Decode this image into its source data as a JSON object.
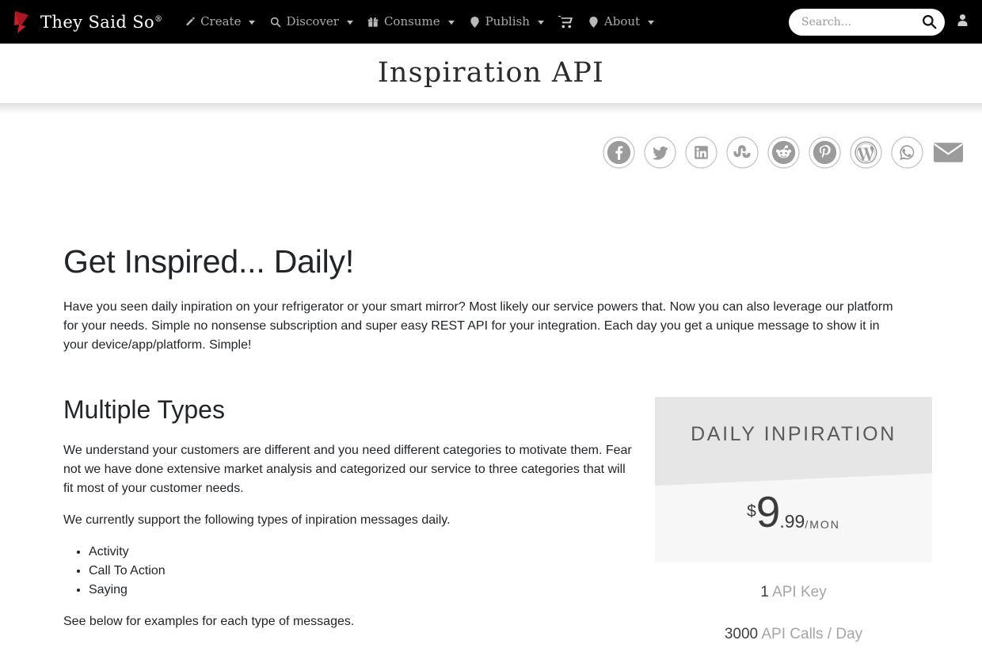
{
  "navbar": {
    "brand": {
      "name": "They Said So",
      "registered": "®",
      "logo_icon": "quill-logo-icon"
    },
    "items": [
      {
        "label": "Create",
        "icon": "pencil-icon",
        "has_caret": true
      },
      {
        "label": "Discover",
        "icon": "search-icon",
        "has_caret": true
      },
      {
        "label": "Consume",
        "icon": "gift-icon",
        "has_caret": true
      },
      {
        "label": "Publish",
        "icon": "location-pin-icon",
        "has_caret": true
      },
      {
        "label": "",
        "icon": "cart-icon",
        "has_caret": false
      },
      {
        "label": "About",
        "icon": "location-pin-icon",
        "has_caret": true
      }
    ],
    "search": {
      "placeholder": "Search...",
      "value": "",
      "button_icon": "search-icon"
    },
    "account_icon": "user-icon"
  },
  "header": {
    "title": "Inspiration API"
  },
  "share": {
    "buttons": [
      {
        "name": "facebook",
        "label": "Facebook"
      },
      {
        "name": "twitter",
        "label": "Twitter"
      },
      {
        "name": "linkedin",
        "label": "LinkedIn"
      },
      {
        "name": "stumbleupon",
        "label": "StumbleUpon"
      },
      {
        "name": "reddit",
        "label": "Reddit"
      },
      {
        "name": "pinterest",
        "label": "Pinterest"
      },
      {
        "name": "wordpress",
        "label": "WordPress"
      },
      {
        "name": "whatsapp",
        "label": "WhatsApp"
      },
      {
        "name": "email",
        "label": "Email"
      }
    ]
  },
  "hero": {
    "title": "Get Inspired... Daily!",
    "paragraph": "Have you seen daily inpiration on your refrigerator or your smart mirror? Most likely our service powers that. Now you can also leverage our platform for your needs. Simple no nonsense subscription and super easy REST API for your integration. Each day you get a unique message to show it in your device/app/platform. Simple!"
  },
  "multiple_types": {
    "title": "Multiple Types",
    "paragraph_1": "We understand your customers are different and you need different categories to motivate them. Fear not we have done extensive market analysis and categorized our service to three categories that will fit most of your customer needs.",
    "paragraph_2": "We currently support the following types of inpiration messages daily.",
    "types": [
      "Activity",
      "Call To Action",
      "Saying"
    ],
    "paragraph_3": "See below for examples for each type of messages."
  },
  "pricing": {
    "plan_name": "DAILY INPIRATION",
    "currency": "$",
    "amount": "9",
    "cents": ".99",
    "period": "/MON",
    "features": [
      {
        "num": "1",
        "text": "API Key"
      },
      {
        "num": "3000",
        "text": "API Calls / Day"
      }
    ]
  },
  "colors": {
    "navbar_bg": "#000000",
    "brand_red": "#c8202a",
    "text": "#212529",
    "muted": "#a6a6a6",
    "card_head": "#e6e6e6",
    "card_body": "#f7f7f7"
  }
}
